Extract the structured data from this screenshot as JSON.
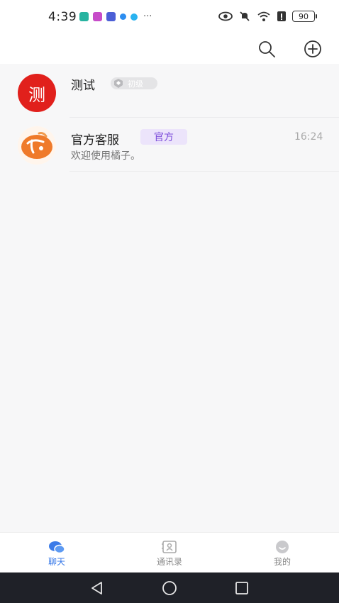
{
  "status_bar": {
    "time": "4:39",
    "dots": "···",
    "battery": "90",
    "app_colors": [
      "#27b3a0",
      "#c74cc9",
      "#4c5fd6",
      "#2c8df0",
      "#2ab3f0"
    ]
  },
  "header": {
    "search_icon": "search-icon",
    "add_icon": "plus-circle-icon"
  },
  "chats": {
    "pinned": {
      "avatar_text": "测",
      "name": "测试",
      "level_badge": "初级",
      "avatar_color": "#e1201c"
    },
    "official": {
      "name": "官方客服",
      "badge": "官方",
      "time": "16:24",
      "preview": "欢迎使用橘子。",
      "badge_color": "#7c4ddb"
    }
  },
  "tabs": [
    {
      "label": "聊天",
      "icon": "chat-bubbles-icon",
      "active": true
    },
    {
      "label": "通讯录",
      "icon": "contacts-book-icon",
      "active": false
    },
    {
      "label": "我的",
      "icon": "profile-icon",
      "active": false
    }
  ],
  "colors": {
    "accent": "#3b7be8",
    "background": "#f7f7f8"
  }
}
